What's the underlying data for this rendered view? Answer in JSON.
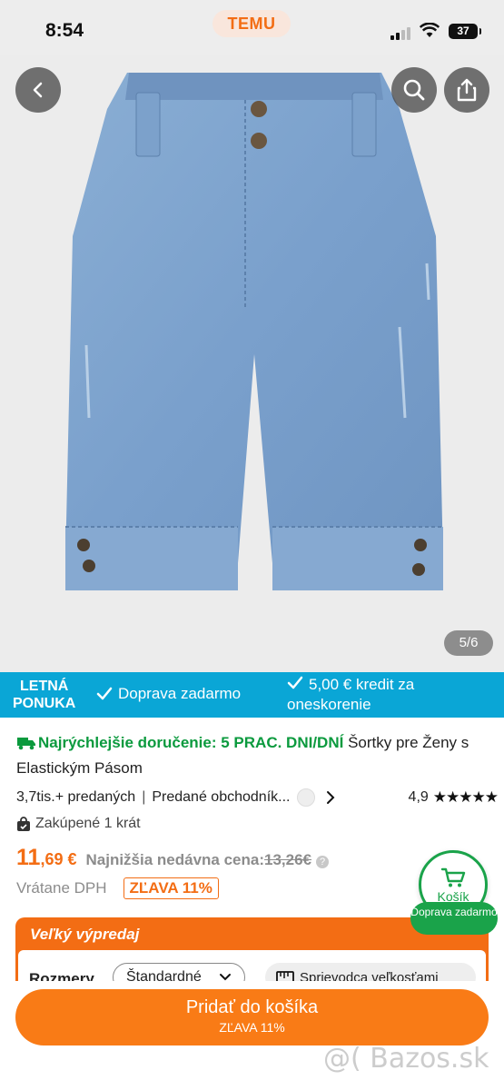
{
  "status_bar": {
    "time": "8:54",
    "app_badge": "TEMU",
    "battery": "37"
  },
  "hero": {
    "pager": "5/6",
    "icons": [
      "back-arrow-icon",
      "search-icon",
      "share-icon"
    ]
  },
  "promo": {
    "badge_line1": "LETNÁ",
    "badge_line2": "PONUKA",
    "item1": "Doprava zadarmo",
    "item2": "5,00 € kredit za oneskorenie",
    "color": "#0aa6d6"
  },
  "product": {
    "delivery_highlight": "Najrýchlejšie doručenie: 5 PRAC. DNI/DNÍ",
    "title": "Šortky pre Ženy s Elastickým Pásom",
    "sold": "3,7tis.+ predaných",
    "store": "Predané obchodník...",
    "rating": "4,9",
    "stars": "★★★★★",
    "bought": "Zakúpené 1 krát",
    "price_main": "11",
    "price_cents": ",69 €",
    "old_price_label": "Najnižšia nedávna cena:",
    "old_price": "13,26€",
    "vat": "Vrátane DPH",
    "discount": "ZĽAVA 11%",
    "accent_color": "#f36d14"
  },
  "cart_float": {
    "label": "Košík",
    "delivery": "Doprava zadarmo"
  },
  "sale": {
    "title": "Veľký výpredaj",
    "sizes_label": "Rozmery",
    "size_value": "Štandardné",
    "size_guide": "Sprievodca veľkosťami"
  },
  "bottom": {
    "add_to_cart": "Pridať do košíka",
    "add_to_cart_sub": "ZĽAVA 11%",
    "watermark": "@( Bazos.sk"
  }
}
